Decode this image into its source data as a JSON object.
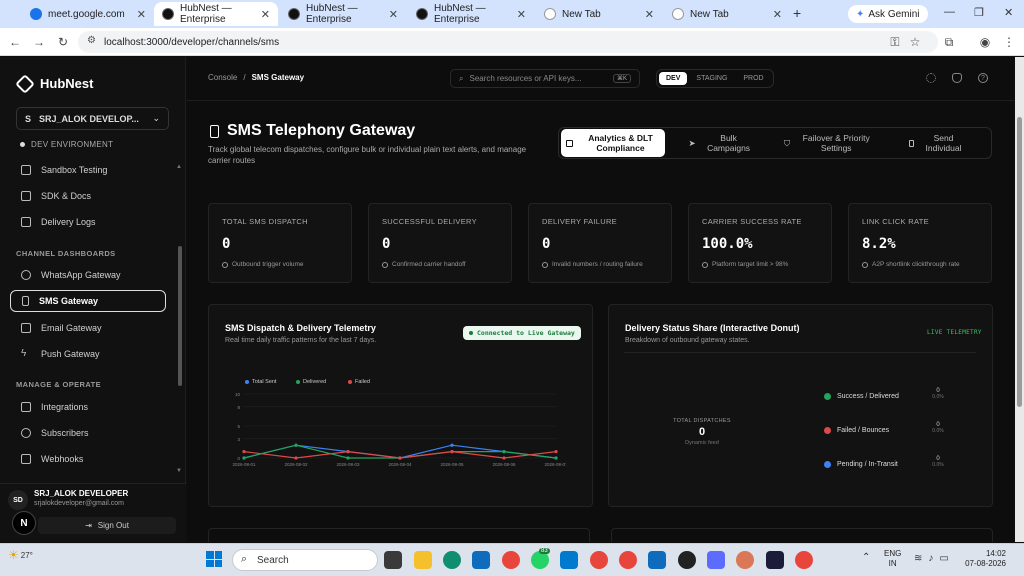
{
  "browser": {
    "tabs": [
      {
        "label": "meet.google.com",
        "color": "#1a73e8"
      },
      {
        "label": "HubNest — Enterprise",
        "color": "#111"
      },
      {
        "label": "HubNest — Enterprise",
        "color": "#111"
      },
      {
        "label": "HubNest — Enterprise",
        "color": "#111"
      },
      {
        "label": "New Tab",
        "color": "#5f6368"
      },
      {
        "label": "New Tab",
        "color": "#5f6368"
      }
    ],
    "gemini": "Ask Gemini",
    "url": "localhost:3000/developer/channels/sms"
  },
  "sidebar": {
    "brand": "HubNest",
    "workspace": "SRJ_ALOK DEVELOP...",
    "workspace_initial": "S",
    "env": "DEV ENVIRONMENT",
    "items_top": [
      "Sandbox Testing",
      "SDK & Docs",
      "Delivery Logs"
    ],
    "section_channels": "CHANNEL DASHBOARDS",
    "channels": [
      "WhatsApp Gateway",
      "SMS Gateway",
      "Email Gateway",
      "Push Gateway"
    ],
    "section_manage": "MANAGE & OPERATE",
    "manage": [
      "Integrations",
      "Subscribers",
      "Webhooks"
    ],
    "user": {
      "initials": "SD",
      "name": "SRJ_ALOK DEVELOPER",
      "email": "srjalokdeveloper@gmail.com",
      "signout": "Sign Out",
      "badge": "N"
    }
  },
  "topbar": {
    "crumb_root": "Console",
    "crumb_sep": "/",
    "crumb_current": "SMS Gateway",
    "search_placeholder": "Search resources or API keys...",
    "search_kbd": "⌘K",
    "envs": [
      "DEV",
      "STAGING",
      "PROD"
    ]
  },
  "page": {
    "title": "SMS Telephony Gateway",
    "subtitle": "Track global telecom dispatches, configure bulk or individual plain text alerts, and manage carrier routes",
    "tabs": [
      "Analytics & DLT Compliance",
      "Bulk Campaigns",
      "Failover & Priority Settings",
      "Send Individual"
    ]
  },
  "kpis": [
    {
      "label": "TOTAL SMS DISPATCH",
      "value": "0",
      "note": "Outbound trigger volume"
    },
    {
      "label": "SUCCESSFUL DELIVERY",
      "value": "0",
      "note": "Confirmed carrier handoff"
    },
    {
      "label": "DELIVERY FAILURE",
      "value": "0",
      "note": "Invalid numbers / routing failure"
    },
    {
      "label": "CARRIER SUCCESS RATE",
      "value": "100.0%",
      "note": "Platform target limit > 98%"
    },
    {
      "label": "LINK CLICK RATE",
      "value": "8.2%",
      "note": "A2P shortlink clickthrough rate"
    }
  ],
  "telemetry": {
    "title": "SMS Dispatch & Delivery Telemetry",
    "subtitle": "Real time daily traffic patterns for the last 7 days.",
    "badge": "Connected to Live Gateway"
  },
  "donut": {
    "title": "Delivery Status Share (Interactive Donut)",
    "subtitle": "Breakdown of outbound gateway states.",
    "tag": "LIVE TELEMETRY",
    "center_label": "TOTAL DISPATCHES",
    "center_value": "0",
    "center_note": "Dynamic feed",
    "items": [
      {
        "label": "Success / Delivered",
        "value": "0",
        "pct": "0.0%",
        "color": "#22a55b"
      },
      {
        "label": "Failed / Bounces",
        "value": "0",
        "pct": "0.0%",
        "color": "#e04848"
      },
      {
        "label": "Pending / In-Transit",
        "value": "0",
        "pct": "0.0%",
        "color": "#3b82f6"
      }
    ]
  },
  "chart_data": {
    "type": "line",
    "x": [
      "2026-08-01",
      "2026-08-02",
      "2026-08-03",
      "2026-08-04",
      "2026-08-05",
      "2026-08-06",
      "2026-08-07"
    ],
    "yticks": [
      "10",
      "8",
      "5",
      "3",
      "0"
    ],
    "ylim": [
      0,
      10
    ],
    "series": [
      {
        "name": "Total Sent",
        "color": "#3b82f6",
        "values": [
          0,
          2,
          1,
          0,
          2,
          1,
          0
        ]
      },
      {
        "name": "Delivered",
        "color": "#22a55b",
        "values": [
          0,
          2,
          0,
          0,
          1,
          1,
          0
        ]
      },
      {
        "name": "Failed",
        "color": "#e04848",
        "values": [
          1,
          0,
          1,
          0,
          1,
          0,
          1
        ]
      }
    ],
    "legend": "top-left",
    "grid": true
  },
  "taskbar": {
    "weather": "27°",
    "search": "Search",
    "lang1": "ENG",
    "lang2": "IN",
    "time": "14:02",
    "date": "07-08-2026",
    "whatsapp_badge": "83"
  }
}
